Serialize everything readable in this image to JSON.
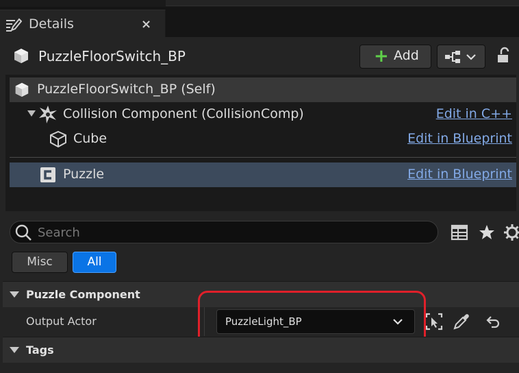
{
  "tab": {
    "title": "Details",
    "close": "×"
  },
  "header": {
    "actor_name": "PuzzleFloorSwitch_BP",
    "add_label": "Add",
    "add_plus": "+"
  },
  "components": [
    {
      "label": "PuzzleFloorSwitch_BP (Self)",
      "link": ""
    },
    {
      "label": "Collision Component (CollisionComp)",
      "link": "Edit in C++"
    },
    {
      "label": "Cube",
      "link": "Edit in Blueprint"
    },
    {
      "label": "Puzzle",
      "link": "Edit in Blueprint"
    }
  ],
  "search": {
    "placeholder": "Search"
  },
  "filters": {
    "misc": "Misc",
    "all": "All"
  },
  "categories": {
    "puzzle_component": "Puzzle Component",
    "tags": "Tags"
  },
  "properties": {
    "output_actor_label": "Output Actor",
    "output_actor_value": "PuzzleLight_BP"
  },
  "colors": {
    "accent": "#0a74e6",
    "link": "#82a9e6",
    "highlight": "#e0202a",
    "add_plus": "#5fd04a"
  }
}
